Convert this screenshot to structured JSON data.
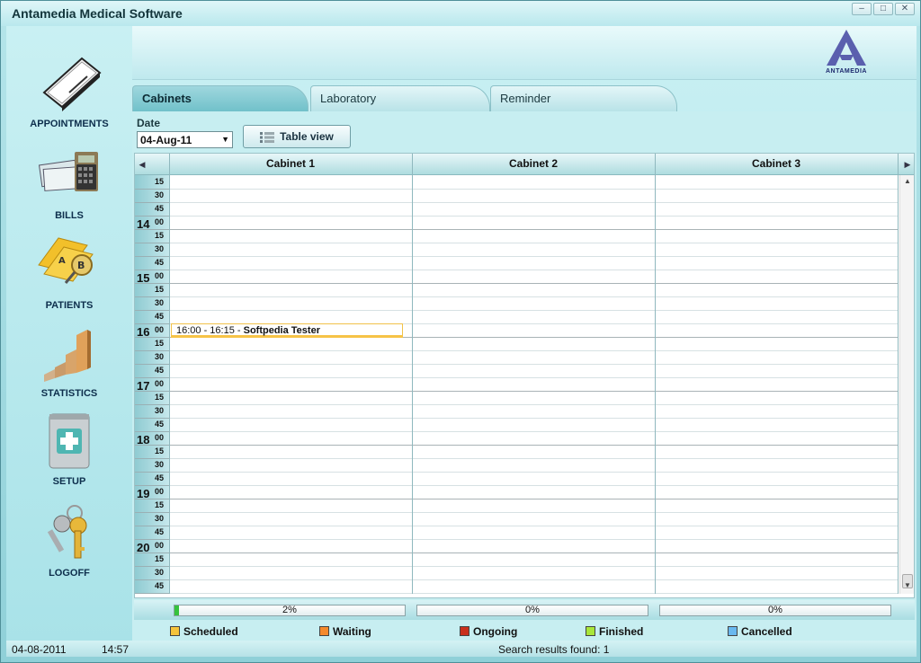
{
  "window": {
    "title": "Antamedia Medical Software"
  },
  "sidebar": {
    "items": [
      {
        "label": "APPOINTMENTS"
      },
      {
        "label": "BILLS"
      },
      {
        "label": "PATIENTS"
      },
      {
        "label": "STATISTICS"
      },
      {
        "label": "SETUP"
      },
      {
        "label": "LOGOFF"
      }
    ]
  },
  "logo": {
    "text": "ANTAMEDIA"
  },
  "tabs": [
    {
      "label": "Cabinets",
      "active": true
    },
    {
      "label": "Laboratory",
      "active": false
    },
    {
      "label": "Reminder",
      "active": false
    }
  ],
  "toolbar": {
    "date_label": "Date",
    "date_value": "04-Aug-11",
    "table_view_label": "Table view"
  },
  "calendar": {
    "columns": [
      "Cabinet  1",
      "Cabinet  2",
      "Cabinet  3"
    ],
    "leading_minutes": [
      "15",
      "30",
      "45"
    ],
    "hours": [
      "14",
      "15",
      "16",
      "17",
      "18",
      "19",
      "20"
    ],
    "minutes": [
      "00",
      "15",
      "30",
      "45"
    ],
    "appointment": {
      "time": "16:00 - 16:15 - ",
      "name": "Softpedia Tester"
    }
  },
  "progress": [
    {
      "value": 2,
      "label": "2%"
    },
    {
      "value": 0,
      "label": "0%"
    },
    {
      "value": 0,
      "label": "0%"
    }
  ],
  "legend": [
    {
      "label": "Scheduled",
      "color": "#f5c33c"
    },
    {
      "label": "Waiting",
      "color": "#f58a2c"
    },
    {
      "label": "Ongoing",
      "color": "#c9301c"
    },
    {
      "label": "Finished",
      "color": "#a8e63a"
    },
    {
      "label": "Cancelled",
      "color": "#69b8ef"
    }
  ],
  "status": {
    "date": "04-08-2011",
    "time": "14:57",
    "search_results": "Search results found: 1"
  }
}
